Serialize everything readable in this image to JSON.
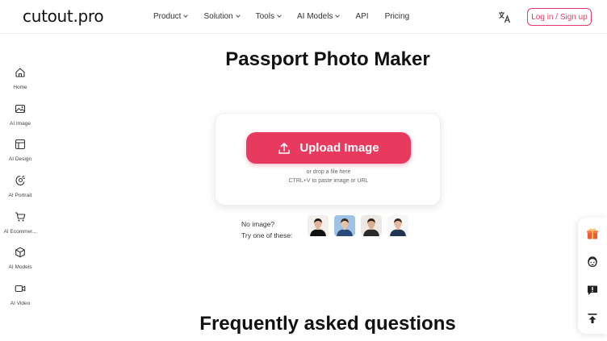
{
  "header": {
    "logo": "cutout.pro",
    "nav": [
      {
        "label": "Product",
        "caret": true
      },
      {
        "label": "Solution",
        "caret": true
      },
      {
        "label": "Tools",
        "caret": true
      },
      {
        "label": "AI Models",
        "caret": true
      },
      {
        "label": "API",
        "caret": false
      },
      {
        "label": "Pricing",
        "caret": false
      }
    ],
    "language_icon": "translate-icon",
    "login_label": "Log in / Sign up"
  },
  "sidebar": {
    "items": [
      {
        "label": "Home",
        "icon": "home-icon"
      },
      {
        "label": "AI Image",
        "icon": "image-icon"
      },
      {
        "label": "AI Design",
        "icon": "design-icon"
      },
      {
        "label": "AI Portrait",
        "icon": "portrait-icon"
      },
      {
        "label": "AI Ecommer...",
        "icon": "cart-icon"
      },
      {
        "label": "AI Models",
        "icon": "cube-icon"
      },
      {
        "label": "AI Video",
        "icon": "video-icon"
      }
    ]
  },
  "main": {
    "title": "Passport Photo Maker",
    "upload_label": "Upload Image",
    "drop_text": "or drop a file here",
    "paste_text": "CTRL+V to paste image or URL",
    "no_image_line1": "No image?",
    "no_image_line2": "Try one of these:",
    "faq_title": "Frequently asked questions"
  },
  "samples": [
    {
      "bg": "#f3efe9",
      "hair": "#1b1b1b",
      "skin": "#e2b59b",
      "shirt": "#111111"
    },
    {
      "bg": "#9fc3e6",
      "hair": "#3a2a22",
      "skin": "#e8c2a6",
      "shirt": "#2a4c7c"
    },
    {
      "bg": "#ece9e4",
      "hair": "#2b2019",
      "skin": "#dcae92",
      "shirt": "#2a2a2a"
    },
    {
      "bg": "#f6f6f6",
      "hair": "#3b2a1f",
      "skin": "#e4b99d",
      "shirt": "#1f3552"
    }
  ],
  "right_toolbar": {
    "items": [
      "gift-icon",
      "support-agent-icon",
      "feedback-icon",
      "back-to-top-icon"
    ]
  },
  "colors": {
    "accent": "#e8395f",
    "login_border": "#e83a6a"
  }
}
